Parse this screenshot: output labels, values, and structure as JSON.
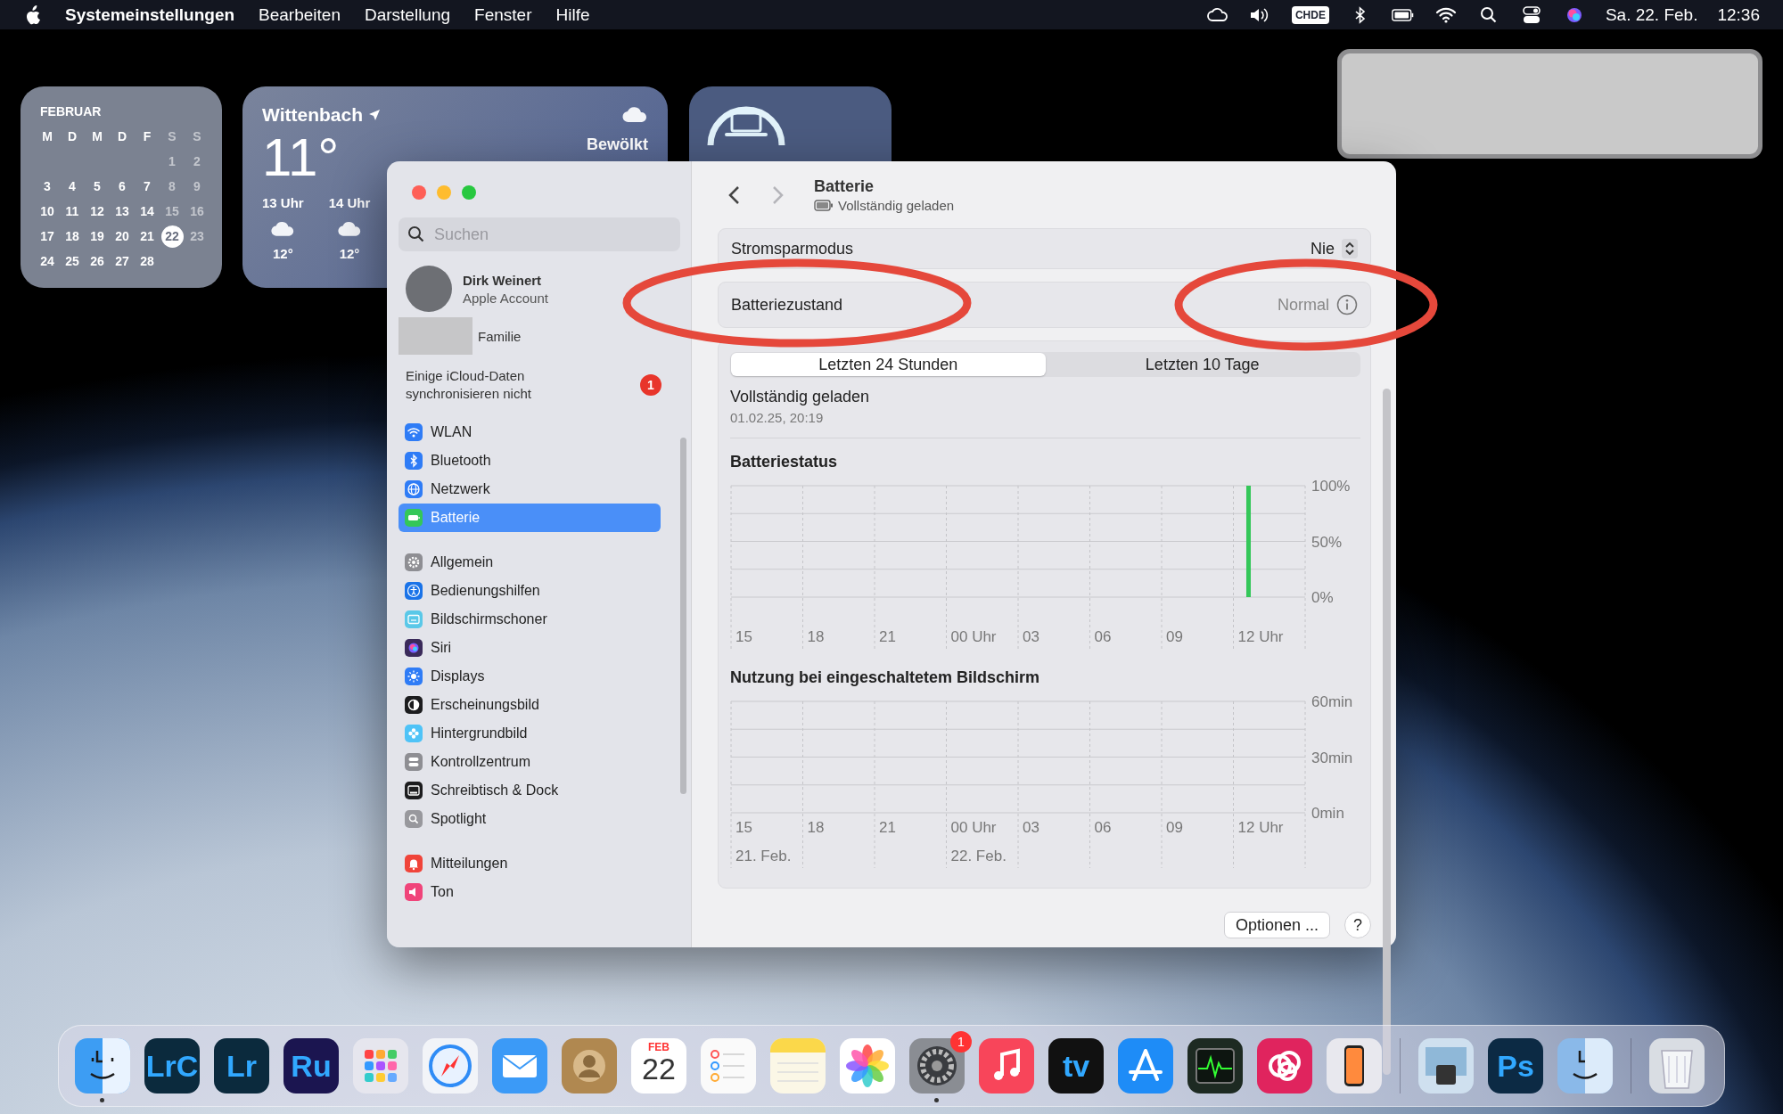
{
  "menu_bar": {
    "app_name": "Systemeinstellungen",
    "menus": [
      "Bearbeiten",
      "Darstellung",
      "Fenster",
      "Hilfe"
    ],
    "input_source": "CHDE",
    "date": "Sa. 22. Feb.",
    "time": "12:36"
  },
  "calendar_widget": {
    "month": "FEBRUAR",
    "weekdays": [
      {
        "label": "M",
        "weekend": false
      },
      {
        "label": "D",
        "weekend": false
      },
      {
        "label": "M",
        "weekend": false
      },
      {
        "label": "D",
        "weekend": false
      },
      {
        "label": "F",
        "weekend": false
      },
      {
        "label": "S",
        "weekend": true
      },
      {
        "label": "S",
        "weekend": true
      }
    ],
    "weeks": [
      [
        {
          "day": "1",
          "today": false
        },
        {
          "day": "2",
          "today": false
        }
      ],
      [
        {
          "day": "3",
          "today": false
        },
        {
          "day": "4",
          "today": false
        },
        {
          "day": "5",
          "today": false
        },
        {
          "day": "6",
          "today": false
        },
        {
          "day": "7",
          "today": false
        },
        {
          "day": "8",
          "today": false
        },
        {
          "day": "9",
          "today": false
        }
      ],
      [
        {
          "day": "10",
          "today": false
        },
        {
          "day": "11",
          "today": false
        },
        {
          "day": "12",
          "today": false
        },
        {
          "day": "13",
          "today": false
        },
        {
          "day": "14",
          "today": false
        },
        {
          "day": "15",
          "today": false
        },
        {
          "day": "16",
          "today": false
        }
      ],
      [
        {
          "day": "17",
          "today": false
        },
        {
          "day": "18",
          "today": false
        },
        {
          "day": "19",
          "today": false
        },
        {
          "day": "20",
          "today": false
        },
        {
          "day": "21",
          "today": false
        },
        {
          "day": "22",
          "today": true
        },
        {
          "day": "23",
          "today": false
        }
      ],
      [
        {
          "day": "24",
          "today": false
        },
        {
          "day": "25",
          "today": false
        },
        {
          "day": "26",
          "today": false
        },
        {
          "day": "27",
          "today": false
        },
        {
          "day": "28",
          "today": false
        }
      ]
    ]
  },
  "weather_widget": {
    "city": "Wittenbach",
    "temperature": "11°",
    "condition": "Bewölkt",
    "hourly": [
      {
        "time": "13 Uhr",
        "temperature": "12°"
      },
      {
        "time": "14 Uhr",
        "temperature": "12°"
      }
    ]
  },
  "window": {
    "sidebar": {
      "search": {
        "placeholder": "Suchen"
      },
      "account": {
        "name": "Dirk Weinert",
        "subtitle": "Apple Account"
      },
      "family": {
        "label": "Familie"
      },
      "notice": {
        "text": "Einige iCloud-Daten synchronisieren nicht",
        "badge": "1"
      },
      "groups": [
        {
          "items": [
            {
              "label": "WLAN",
              "color": "#2f7cf6",
              "selected": false
            },
            {
              "label": "Bluetooth",
              "color": "#2f7cf6",
              "selected": false
            },
            {
              "label": "Netzwerk",
              "color": "#2f7cf6",
              "selected": false
            },
            {
              "label": "Batterie",
              "color": "#34c759",
              "selected": true
            }
          ]
        },
        {
          "items": [
            {
              "label": "Allgemein",
              "color": "#8e8e93",
              "selected": false
            },
            {
              "label": "Bedienungshilfen",
              "color": "#1a73e8",
              "selected": false
            },
            {
              "label": "Bildschirmschoner",
              "color": "#5ac8e8",
              "selected": false
            },
            {
              "label": "Siri",
              "color": "#3a2a5a",
              "selected": false
            },
            {
              "label": "Displays",
              "color": "#2f7cf6",
              "selected": false
            },
            {
              "label": "Erscheinungsbild",
              "color": "#1c1c1e",
              "selected": false
            },
            {
              "label": "Hintergrundbild",
              "color": "#4fc3f7",
              "selected": false
            },
            {
              "label": "Kontrollzentrum",
              "color": "#8e8e93",
              "selected": false
            },
            {
              "label": "Schreibtisch & Dock",
              "color": "#1c1c1e",
              "selected": false
            },
            {
              "label": "Spotlight",
              "color": "#98989d",
              "selected": false
            }
          ]
        },
        {
          "items": [
            {
              "label": "Mitteilungen",
              "color": "#f0443a",
              "selected": false
            },
            {
              "label": "Ton",
              "color": "#f0447a",
              "selected": false
            }
          ]
        }
      ]
    },
    "main": {
      "nav_buttons": [
        {
          "kind": "back",
          "disabled": false
        },
        {
          "kind": "forward",
          "disabled": true
        }
      ],
      "title": "Batterie",
      "subtitle": "Vollständig geladen",
      "rows": [
        {
          "kind": "popup",
          "label": "Stromsparmodus",
          "value": "Nie",
          "highlighted": false
        },
        {
          "kind": "info",
          "label": "Batteriezustand",
          "value": "Normal",
          "highlighted": true
        }
      ],
      "segments": [
        {
          "label": "Letzten 24 Stunden",
          "selected": true
        },
        {
          "label": "Letzten 10 Tage",
          "selected": false
        }
      ],
      "summary": {
        "title": "Vollständig geladen",
        "date": "01.02.25, 20:19"
      },
      "charts": [
        {
          "chart_data": {
            "type": "bar",
            "title": "Batteriestatus",
            "categories": [
              "15",
              "18",
              "21",
              "00 Uhr",
              "03",
              "06",
              "09",
              "12 Uhr"
            ],
            "series": [
              {
                "color": "#34c759",
                "values": [
                  null,
                  null,
                  null,
                  null,
                  null,
                  null,
                  null,
                  100
                ]
              }
            ],
            "ylim": [
              0,
              100
            ],
            "yticks": [
              {
                "value": 0,
                "label": "0%"
              },
              {
                "value": 50,
                "label": "50%"
              },
              {
                "value": 100,
                "label": "100%"
              }
            ]
          }
        },
        {
          "chart_data": {
            "type": "bar",
            "title": "Nutzung bei eingeschaltetem Bildschirm",
            "categories": [
              "15",
              "18",
              "21",
              "00 Uhr",
              "03",
              "06",
              "09",
              "12 Uhr"
            ],
            "ylim": [
              0,
              60
            ],
            "yticks": [
              {
                "value": 0,
                "label": "0min"
              },
              {
                "value": 30,
                "label": "30min"
              },
              {
                "value": 60,
                "label": "60min"
              }
            ],
            "annotations": [
              "21. Feb.",
              "22. Feb."
            ]
          }
        }
      ],
      "buttons": [
        {
          "kind": "text",
          "label": "Optionen ..."
        },
        {
          "kind": "help",
          "label": "?"
        }
      ]
    }
  },
  "dock": {
    "groups": [
      {
        "apps": [
          {
            "kind": "glyph",
            "color": "#3d9df3",
            "running": true
          },
          {
            "kind": "text",
            "text": "LrC",
            "color": "#0b2a3d",
            "running": false
          },
          {
            "kind": "text",
            "text": "Lr",
            "color": "#0b2a3d",
            "running": false
          },
          {
            "kind": "text",
            "text": "Ru",
            "color": "#1b1550",
            "running": false
          },
          {
            "kind": "glyph",
            "color": "#e6e6ee",
            "running": false
          },
          {
            "kind": "glyph",
            "color": "#f2f4f8",
            "running": false
          },
          {
            "kind": "glyph",
            "color": "#3b9af7",
            "running": false
          },
          {
            "kind": "glyph",
            "color": "#b08850",
            "running": false
          },
          {
            "kind": "calendar",
            "month": "FEB",
            "day": "22",
            "color": "#ffffff",
            "running": false
          },
          {
            "kind": "glyph",
            "color": "#fafafa",
            "running": false
          },
          {
            "kind": "glyph",
            "color": "#fbf7e6",
            "running": false
          },
          {
            "kind": "glyph",
            "color": "#ffffff",
            "running": false
          },
          {
            "kind": "glyph",
            "color": "#8a8d93",
            "badge": "1",
            "running": true
          },
          {
            "kind": "glyph",
            "color": "#f8455a",
            "running": false
          },
          {
            "kind": "text",
            "text": "tv",
            "color": "#111111",
            "running": false
          },
          {
            "kind": "glyph",
            "color": "#1e8cf7",
            "running": false
          },
          {
            "kind": "glyph",
            "color": "#1d2a22",
            "running": false
          },
          {
            "kind": "glyph",
            "color": "#e0245e",
            "running": false
          },
          {
            "kind": "glyph",
            "color": "#e8e8ee",
            "running": false
          }
        ]
      },
      {
        "apps": [
          {
            "kind": "glyph",
            "color": "#cfe0ef",
            "running": false
          },
          {
            "kind": "text",
            "text": "Ps",
            "color": "#0c2a44",
            "running": false
          },
          {
            "kind": "glyph",
            "color": "#8ab9e9",
            "running": false
          }
        ]
      },
      {
        "apps": [
          {
            "kind": "glyph",
            "color": "#d9dde3",
            "running": false
          }
        ]
      }
    ]
  }
}
